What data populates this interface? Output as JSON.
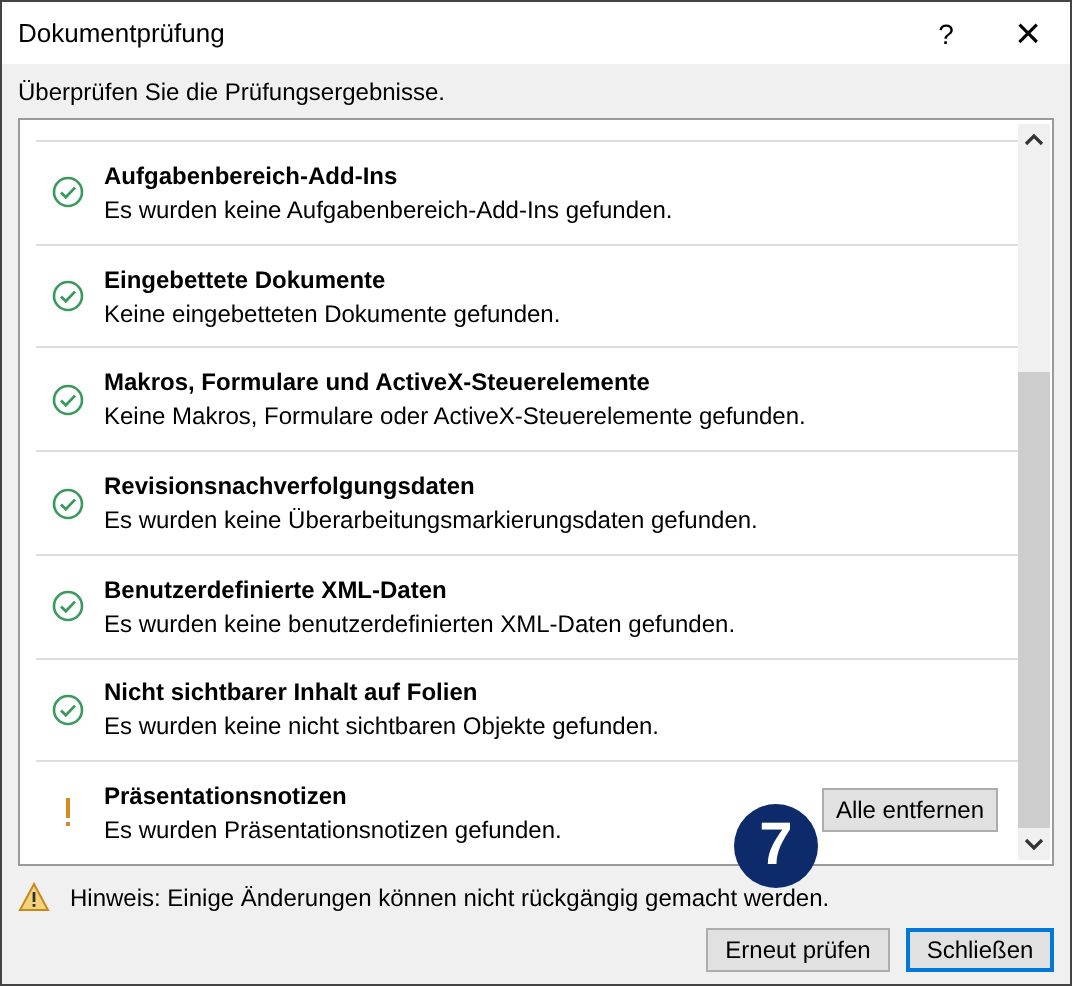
{
  "window": {
    "title": "Dokumentprüfung",
    "help": "?",
    "close": "×"
  },
  "subtitle": "Überprüfen Sie die Prüfungsergebnisse.",
  "results": [
    {
      "kind": "ok",
      "title": "Aufgabenbereich-Add-Ins",
      "description": "Es wurden keine Aufgabenbereich-Add-Ins gefunden."
    },
    {
      "kind": "ok",
      "title": "Eingebettete Dokumente",
      "description": "Keine eingebetteten Dokumente gefunden."
    },
    {
      "kind": "ok",
      "title": "Makros, Formulare und ActiveX-Steuerelemente",
      "description": "Keine Makros, Formulare oder ActiveX-Steuerelemente gefunden."
    },
    {
      "kind": "ok",
      "title": "Revisionsnachverfolgungsdaten",
      "description": "Es wurden keine Überarbeitungsmarkierungsdaten gefunden."
    },
    {
      "kind": "ok",
      "title": "Benutzerdefinierte XML-Daten",
      "description": "Es wurden keine benutzerdefinierten XML-Daten gefunden."
    },
    {
      "kind": "ok",
      "title": "Nicht sichtbarer Inhalt auf Folien",
      "description": "Es wurden keine nicht sichtbaren Objekte gefunden."
    },
    {
      "kind": "issue",
      "title": "Präsentationsnotizen",
      "description": "Es wurden Präsentationsnotizen gefunden.",
      "action": "Alle entfernen"
    }
  ],
  "callout": "7",
  "hint": "Hinweis: Einige Änderungen können nicht rückgängig gemacht werden.",
  "buttons": [
    {
      "label": "Erneut prüfen",
      "default": false
    },
    {
      "label": "Schließen",
      "default": true
    }
  ]
}
